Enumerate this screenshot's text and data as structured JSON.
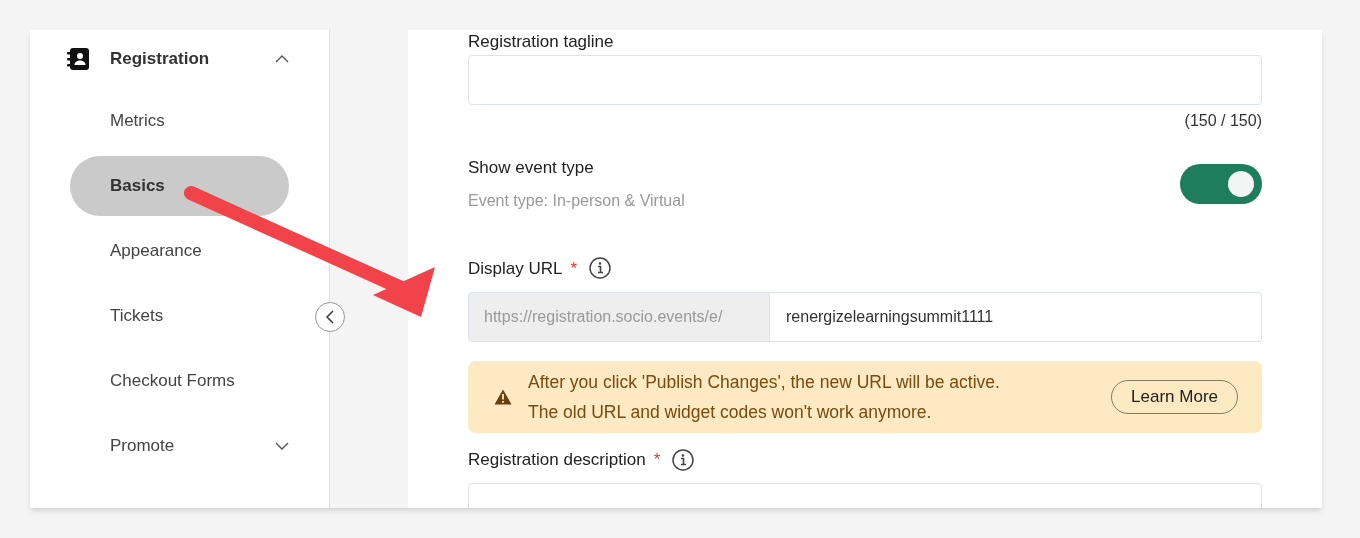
{
  "sidebar": {
    "section": {
      "label": "Registration",
      "expanded": true
    },
    "items": [
      {
        "label": "Metrics",
        "selected": false
      },
      {
        "label": "Basics",
        "selected": true
      },
      {
        "label": "Appearance",
        "selected": false
      },
      {
        "label": "Tickets",
        "selected": false
      },
      {
        "label": "Checkout Forms",
        "selected": false
      },
      {
        "label": "Promote",
        "selected": false,
        "kind": "group",
        "expanded": false
      }
    ]
  },
  "main": {
    "tagline": {
      "label": "Registration tagline",
      "counter": "(150 / 150)"
    },
    "show_event_type": {
      "label": "Show event type",
      "description": "Event type: In-person & Virtual",
      "on": true
    },
    "display_url": {
      "label": "Display URL",
      "required_mark": "*",
      "prefix": "https://registration.socio.events/e/",
      "value": "renergizelearningsummit1111"
    },
    "alert": {
      "message_lines": [
        "After you click 'Publish Changes', the new URL will be active.",
        "The old URL and widget codes won't work anymore."
      ],
      "button": "Learn More"
    },
    "description": {
      "label": "Registration description",
      "required_mark": "*"
    }
  }
}
